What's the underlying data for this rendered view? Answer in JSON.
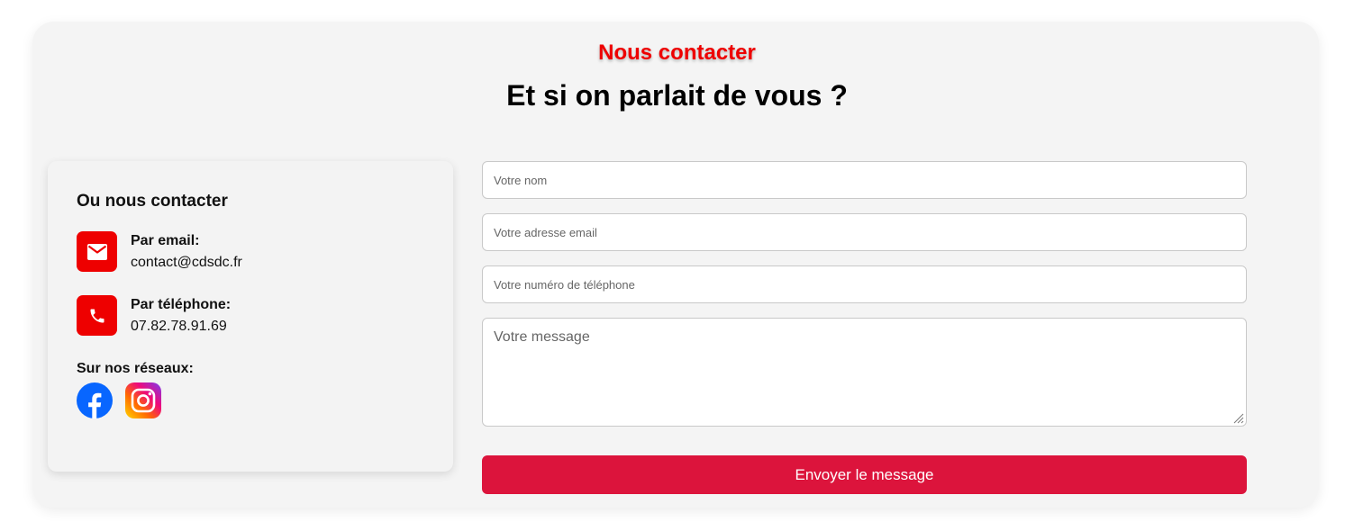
{
  "header": {
    "eyebrow": "Nous contacter",
    "title": "Et si on parlait de vous ?"
  },
  "contact_card": {
    "title": "Ou nous contacter",
    "email": {
      "label": "Par email:",
      "value": "contact@cdsdc.fr",
      "icon": "mail-icon"
    },
    "phone": {
      "label": "Par téléphone:",
      "value": "07.82.78.91.69",
      "icon": "phone-icon"
    },
    "social": {
      "label": "Sur nos réseaux:",
      "items": [
        {
          "name": "facebook",
          "icon": "facebook-icon"
        },
        {
          "name": "instagram",
          "icon": "instagram-icon"
        }
      ]
    }
  },
  "form": {
    "name_placeholder": "Votre nom",
    "email_placeholder": "Votre adresse email",
    "phone_placeholder": "Votre numéro de téléphone",
    "message_placeholder": "Votre message",
    "submit_label": "Envoyer le message"
  },
  "colors": {
    "accent_red": "#ee0000",
    "button_crimson": "#dc143c",
    "facebook_blue": "#0866ff",
    "panel_bg": "#f4f4f4"
  }
}
